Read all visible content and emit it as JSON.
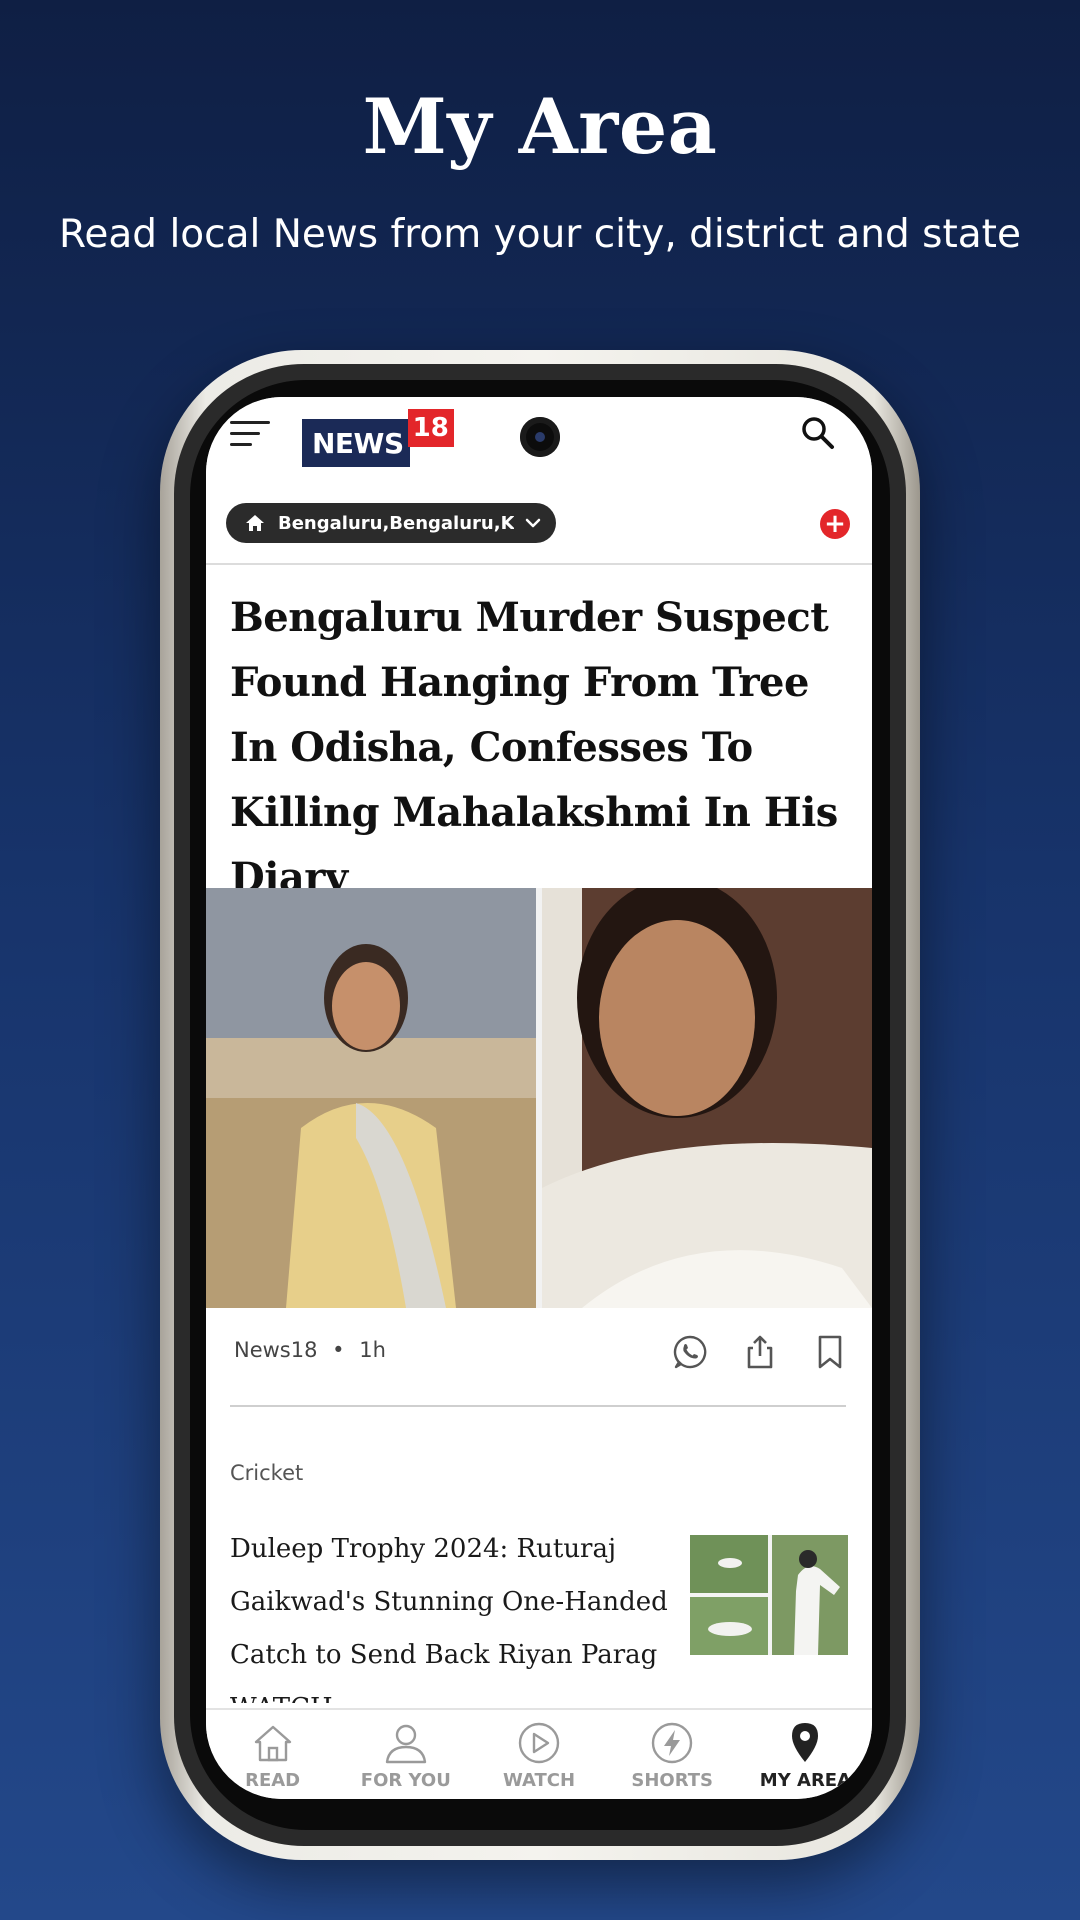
{
  "promo": {
    "title": "My Area",
    "subtitle": "Read local News from your city, district and state"
  },
  "header": {
    "logo_text": "NEWS",
    "logo_number": "18"
  },
  "location": {
    "label": "Bengaluru,Bengaluru,K...",
    "add_label": "+"
  },
  "article": {
    "headline": "Bengaluru Murder Suspect Found Hanging From Tree In Odisha, Confesses To Killing Mahalakshmi In His Diary",
    "source": "News18",
    "separator": "•",
    "time": "1h"
  },
  "story": {
    "category": "Cricket",
    "title": "Duleep Trophy 2024: Ruturaj Gaikwad's Stunning One-Handed Catch to Send Back Riyan Parag WATCH"
  },
  "nav": {
    "items": [
      {
        "label": "READ",
        "icon": "home-icon"
      },
      {
        "label": "FOR YOU",
        "icon": "person-icon"
      },
      {
        "label": "WATCH",
        "icon": "play-icon"
      },
      {
        "label": "SHORTS",
        "icon": "lightning-icon"
      },
      {
        "label": "MY AREA",
        "icon": "location-pin-icon",
        "active": true
      }
    ]
  },
  "colors": {
    "background_top": "#0f1f44",
    "background_bottom": "#23488a",
    "brand_red": "#e3262a",
    "brand_navy": "#1b2a57"
  }
}
